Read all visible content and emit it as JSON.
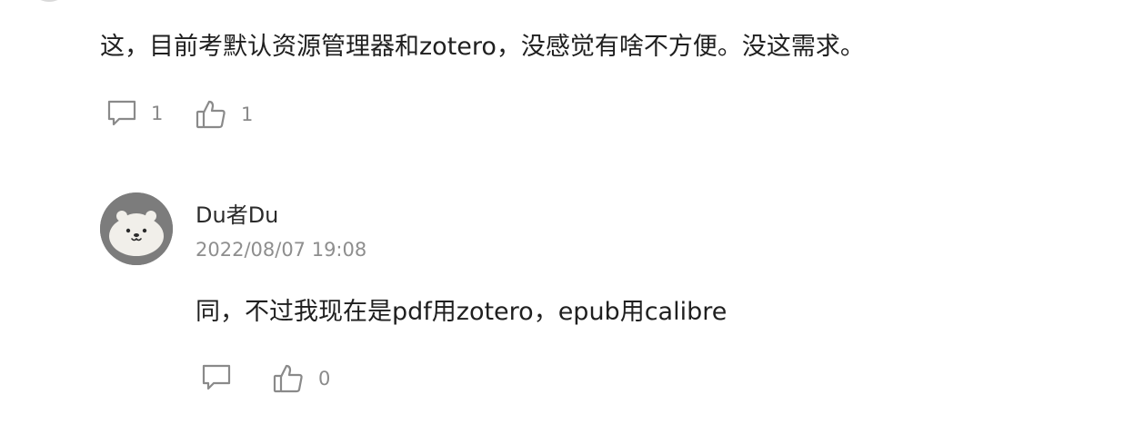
{
  "comments": [
    {
      "text": "这，目前考默认资源管理器和zotero，没感觉有啥不方便。没这需求。",
      "reply_count": "1",
      "like_count": "1",
      "reply_icon": "comment-bubble-icon",
      "like_icon": "thumbs-up-icon"
    },
    {
      "author": "Du者Du",
      "timestamp": "2022/08/07 19:08",
      "avatar_icon": "otter-avatar",
      "text": "同，不过我现在是pdf用zotero，epub用calibre",
      "like_count": "0",
      "reply_icon": "comment-bubble-icon",
      "like_icon": "thumbs-up-icon"
    }
  ],
  "colors": {
    "text": "#1f1f1f",
    "muted": "#8a8a8a",
    "avatar_bg": "#7c7c7c"
  }
}
